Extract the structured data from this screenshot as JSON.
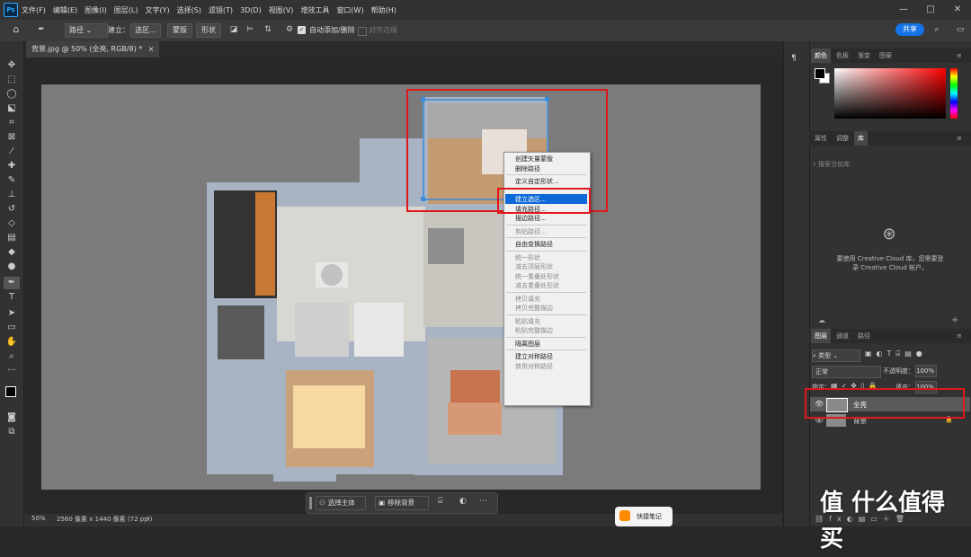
{
  "app": {
    "logo": "Ps",
    "menus": [
      "文件(F)",
      "编辑(E)",
      "图像(I)",
      "图层(L)",
      "文字(Y)",
      "选择(S)",
      "滤镜(T)",
      "3D(D)",
      "视图(V)",
      "增效工具",
      "窗口(W)",
      "帮助(H)"
    ],
    "window_controls": [
      "—",
      "□",
      "✕"
    ]
  },
  "options_bar": {
    "home_icon": "home-icon",
    "pen_icon": "pen-icon",
    "mode": "路径",
    "build_label": "建立：",
    "selection_btn": "选区...",
    "mask_btn": "蒙版",
    "shape_btn": "形状",
    "auto_add_delete": "自动添加/删除",
    "align_edges": "对齐边缘",
    "share_btn": "共享"
  },
  "document": {
    "tab_title": "背景.jpg @ 50% (全亮, RGB/8) *",
    "zoom": "50%",
    "info": "2560 像素 x 1440 像素 (72 ppi)"
  },
  "context_menu": {
    "items": [
      {
        "label": "创建矢量蒙版",
        "disabled": false
      },
      {
        "label": "删除路径",
        "disabled": false
      },
      {
        "sep": true
      },
      {
        "label": "定义自定形状...",
        "disabled": false
      },
      {
        "sep": true
      },
      {
        "label": "建立选区...",
        "disabled": false,
        "highlighted": true
      },
      {
        "label": "填充路径...",
        "disabled": false
      },
      {
        "label": "描边路径...",
        "disabled": false
      },
      {
        "sep": true
      },
      {
        "label": "剪贴路径...",
        "disabled": true
      },
      {
        "sep": true
      },
      {
        "label": "自由变换路径",
        "disabled": false
      },
      {
        "sep": true
      },
      {
        "label": "统一形状",
        "disabled": true
      },
      {
        "label": "减去顶层形状",
        "disabled": true
      },
      {
        "label": "统一重叠处形状",
        "disabled": true
      },
      {
        "label": "减去重叠处形状",
        "disabled": true
      },
      {
        "sep": true
      },
      {
        "label": "拷贝填充",
        "disabled": true
      },
      {
        "label": "拷贝完整描边",
        "disabled": true
      },
      {
        "sep": true
      },
      {
        "label": "粘贴填充",
        "disabled": true
      },
      {
        "label": "粘贴完整描边",
        "disabled": true
      },
      {
        "sep": true
      },
      {
        "label": "隔离图层",
        "disabled": false
      },
      {
        "sep": true
      },
      {
        "label": "建立对称路径",
        "disabled": false
      },
      {
        "label": "禁用对称路径",
        "disabled": true
      }
    ]
  },
  "contextual_taskbar": {
    "select_subject": "选择主体",
    "remove_bg": "移除背景",
    "more": "···"
  },
  "panels": {
    "color_tabs": [
      "颜色",
      "色板",
      "渐变",
      "图案"
    ],
    "library_tabs": [
      "属性",
      "调整",
      "库"
    ],
    "library_search_placeholder": "搜索当前库",
    "cc_message_line1": "要使用 Creative Cloud 库，您需要登",
    "cc_message_line2": "录 Creative Cloud 帐户。",
    "layers_tabs": [
      "图层",
      "通道",
      "路径"
    ],
    "filter_kind": "类型",
    "blend_mode": "正常",
    "opacity_label": "不透明度：",
    "opacity_value": "100%",
    "lock_label": "锁定：",
    "fill_label": "填充：",
    "fill_value": "100%",
    "layers": [
      {
        "name": "全亮",
        "selected": true
      },
      {
        "name": "背景",
        "selected": false,
        "locked": true
      }
    ]
  },
  "taskbar_note": "快捷笔记",
  "watermark": "值 什么值得买",
  "colors": {
    "highlight_red": "#e0181b",
    "accent_blue": "#1473e6",
    "menu_highlight": "#0e69d8"
  }
}
